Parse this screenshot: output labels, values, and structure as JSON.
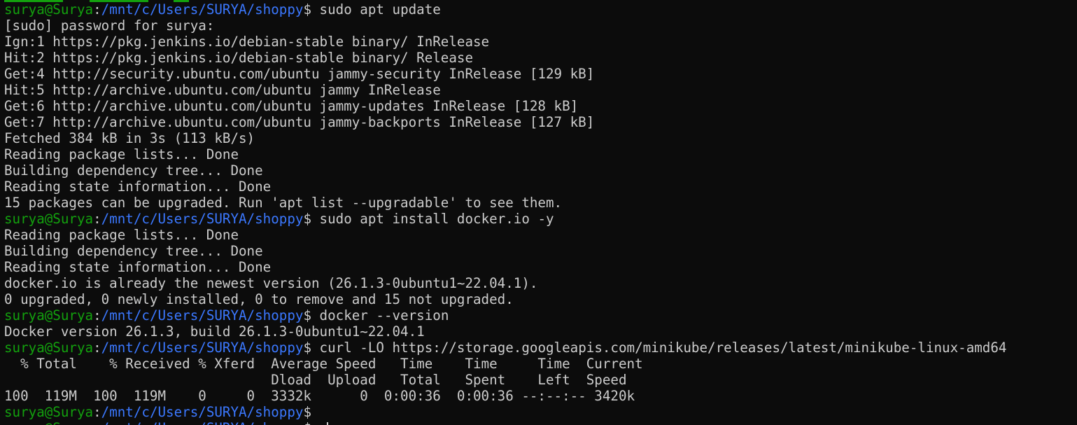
{
  "prompt": {
    "user_host": "surya@Surya",
    "path": "/mnt/c/Users/SURYA/shoppy",
    "symbol": "$"
  },
  "lines": [
    {
      "type": "prompt",
      "command": " sudo apt update"
    },
    {
      "type": "output",
      "text": "[sudo] password for surya:"
    },
    {
      "type": "output",
      "text": "Ign:1 https://pkg.jenkins.io/debian-stable binary/ InRelease"
    },
    {
      "type": "output",
      "text": "Hit:2 https://pkg.jenkins.io/debian-stable binary/ Release"
    },
    {
      "type": "output",
      "text": "Get:4 http://security.ubuntu.com/ubuntu jammy-security InRelease [129 kB]"
    },
    {
      "type": "output",
      "text": "Hit:5 http://archive.ubuntu.com/ubuntu jammy InRelease"
    },
    {
      "type": "output",
      "text": "Get:6 http://archive.ubuntu.com/ubuntu jammy-updates InRelease [128 kB]"
    },
    {
      "type": "output",
      "text": "Get:7 http://archive.ubuntu.com/ubuntu jammy-backports InRelease [127 kB]"
    },
    {
      "type": "output",
      "text": "Fetched 384 kB in 3s (113 kB/s)"
    },
    {
      "type": "output",
      "text": "Reading package lists... Done"
    },
    {
      "type": "output",
      "text": "Building dependency tree... Done"
    },
    {
      "type": "output",
      "text": "Reading state information... Done"
    },
    {
      "type": "output",
      "text": "15 packages can be upgraded. Run 'apt list --upgradable' to see them."
    },
    {
      "type": "prompt",
      "command": " sudo apt install docker.io -y"
    },
    {
      "type": "output",
      "text": "Reading package lists... Done"
    },
    {
      "type": "output",
      "text": "Building dependency tree... Done"
    },
    {
      "type": "output",
      "text": "Reading state information... Done"
    },
    {
      "type": "output",
      "text": "docker.io is already the newest version (26.1.3-0ubuntu1~22.04.1)."
    },
    {
      "type": "output",
      "text": "0 upgraded, 0 newly installed, 0 to remove and 15 not upgraded."
    },
    {
      "type": "prompt",
      "command": " docker --version"
    },
    {
      "type": "output",
      "text": "Docker version 26.1.3, build 26.1.3-0ubuntu1~22.04.1"
    },
    {
      "type": "prompt",
      "command": " curl -LO https://storage.googleapis.com/minikube/releases/latest/minikube-linux-amd64"
    },
    {
      "type": "output",
      "text": "  % Total    % Received % Xferd  Average Speed   Time    Time     Time  Current"
    },
    {
      "type": "output",
      "text": "                                 Dload  Upload   Total   Spent    Left  Speed"
    },
    {
      "type": "output",
      "text": "100  119M  100  119M    0     0  3332k      0  0:00:36  0:00:36 --:--:-- 3420k"
    },
    {
      "type": "prompt",
      "command": ""
    },
    {
      "type": "prompt-active",
      "command": " "
    }
  ],
  "colors": {
    "background": "#0c0c0c",
    "foreground": "#cccccc",
    "user_host": "#13a10e",
    "path": "#3b78ff"
  }
}
